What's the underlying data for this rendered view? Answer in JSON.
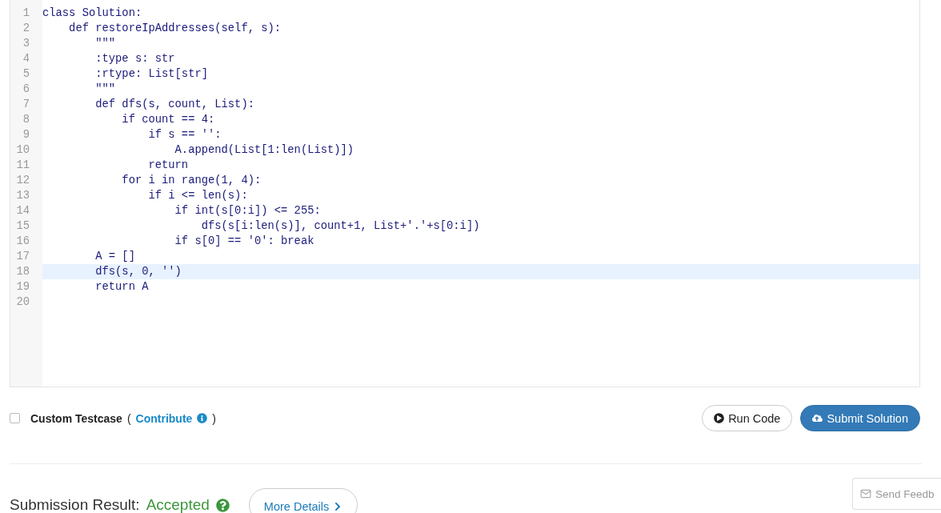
{
  "editor": {
    "lines": [
      {
        "number": "1",
        "active": false,
        "text": "class Solution:"
      },
      {
        "number": "2",
        "active": false,
        "text": "    def restoreIpAddresses(self, s):"
      },
      {
        "number": "3",
        "active": false,
        "text": "        \"\"\""
      },
      {
        "number": "4",
        "active": false,
        "text": "        :type s: str"
      },
      {
        "number": "5",
        "active": false,
        "text": "        :rtype: List[str]"
      },
      {
        "number": "6",
        "active": false,
        "text": "        \"\"\""
      },
      {
        "number": "7",
        "active": false,
        "text": "        def dfs(s, count, List):"
      },
      {
        "number": "8",
        "active": false,
        "text": "            if count == 4:"
      },
      {
        "number": "9",
        "active": false,
        "text": "                if s == '':"
      },
      {
        "number": "10",
        "active": false,
        "text": "                    A.append(List[1:len(List)])"
      },
      {
        "number": "11",
        "active": false,
        "text": "                return"
      },
      {
        "number": "12",
        "active": false,
        "text": "            for i in range(1, 4):"
      },
      {
        "number": "13",
        "active": false,
        "text": "                if i <= len(s):"
      },
      {
        "number": "14",
        "active": false,
        "text": "                    if int(s[0:i]) <= 255:"
      },
      {
        "number": "15",
        "active": false,
        "text": "                        dfs(s[i:len(s)], count+1, List+'.'+s[0:i])"
      },
      {
        "number": "16",
        "active": false,
        "text": "                    if s[0] == '0': break"
      },
      {
        "number": "17",
        "active": false,
        "text": "        A = []"
      },
      {
        "number": "18",
        "active": true,
        "text": "        dfs(s, 0, '')"
      },
      {
        "number": "19",
        "active": false,
        "text": "        return A"
      },
      {
        "number": "20",
        "active": false
      }
    ]
  },
  "testcase": {
    "checked": false,
    "label": "Custom Testcase",
    "open_paren": "(",
    "link": "Contribute",
    "close_paren": ")"
  },
  "actions": [
    {
      "kind": "run",
      "label": "Run Code"
    },
    {
      "kind": "submit",
      "label": "Submit Solution"
    }
  ],
  "result": {
    "label": "Submission Result:",
    "status": "Accepted",
    "details_button": "More Details"
  },
  "feedback_button": "Send Feedb"
}
